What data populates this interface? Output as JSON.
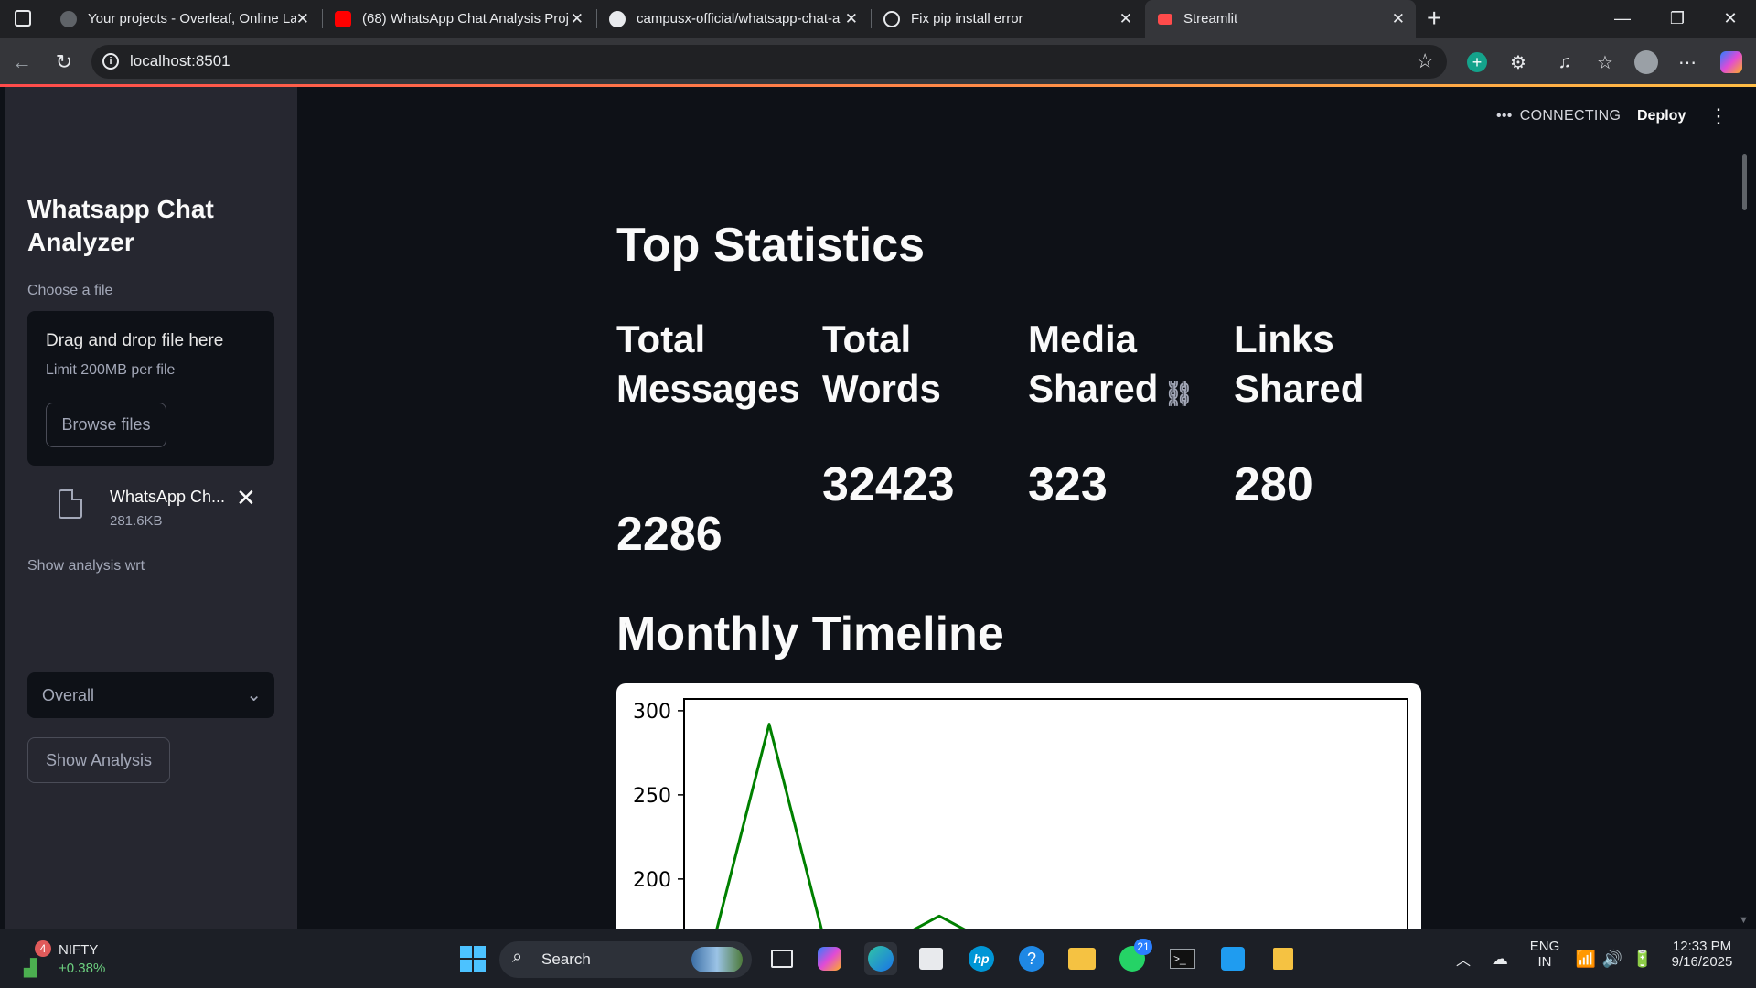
{
  "browser": {
    "tabs": [
      {
        "title": "Your projects - Overleaf, Online La",
        "icon": "overleaf-icon",
        "color": "#9aa0a6"
      },
      {
        "title": "(68) WhatsApp Chat Analysis Proj",
        "icon": "youtube-icon",
        "color": "#ff0000"
      },
      {
        "title": "campusx-official/whatsapp-chat-a",
        "icon": "github-icon",
        "color": "#e8eaed"
      },
      {
        "title": "Fix pip install error",
        "icon": "chatgpt-icon",
        "color": "#e8eaed"
      },
      {
        "title": "Streamlit",
        "icon": "streamlit-icon",
        "color": "#ff4b4b"
      }
    ],
    "url": "localhost:8501"
  },
  "sidebar": {
    "title": "Whatsapp Chat Analyzer",
    "uploader_label": "Choose a file",
    "drop_text": "Drag and drop file here",
    "limit_text": "Limit 200MB per file",
    "browse_label": "Browse files",
    "file_name": "WhatsApp Ch...",
    "file_size": "281.6KB",
    "select_label": "Show analysis wrt",
    "select_value": "Overall",
    "analysis_button": "Show Analysis"
  },
  "header": {
    "status": "CONNECTING",
    "deploy": "Deploy"
  },
  "main": {
    "title": "Top Statistics",
    "metrics": [
      {
        "label_1": "Total",
        "label_2": "Messages",
        "value": "2286"
      },
      {
        "label_1": "Total",
        "label_2": "Words",
        "value": "32423"
      },
      {
        "label_1": "Media",
        "label_2": "Shared",
        "value": "323"
      },
      {
        "label_1": "Links",
        "label_2": "Shared",
        "value": "280"
      }
    ],
    "timeline_title": "Monthly Timeline"
  },
  "chart_data": {
    "type": "line",
    "title": "",
    "xlabel": "",
    "ylabel": "",
    "y_ticks": [
      300,
      250,
      200
    ],
    "ylim_visible": [
      167,
      307
    ],
    "series": [
      {
        "color": "#008000",
        "points": [
          [
            0,
            160
          ],
          [
            1,
            292
          ],
          [
            2,
            160
          ],
          [
            3,
            160
          ],
          [
            4,
            178
          ],
          [
            5,
            160
          ]
        ]
      }
    ]
  },
  "taskbar": {
    "nifty_badge": "4",
    "nifty_label": "NIFTY",
    "nifty_change": "+0.38%",
    "search_label": "Search",
    "whatsapp_badge": "21",
    "lang_1": "ENG",
    "lang_2": "IN",
    "time": "12:33 PM",
    "date": "9/16/2025"
  }
}
